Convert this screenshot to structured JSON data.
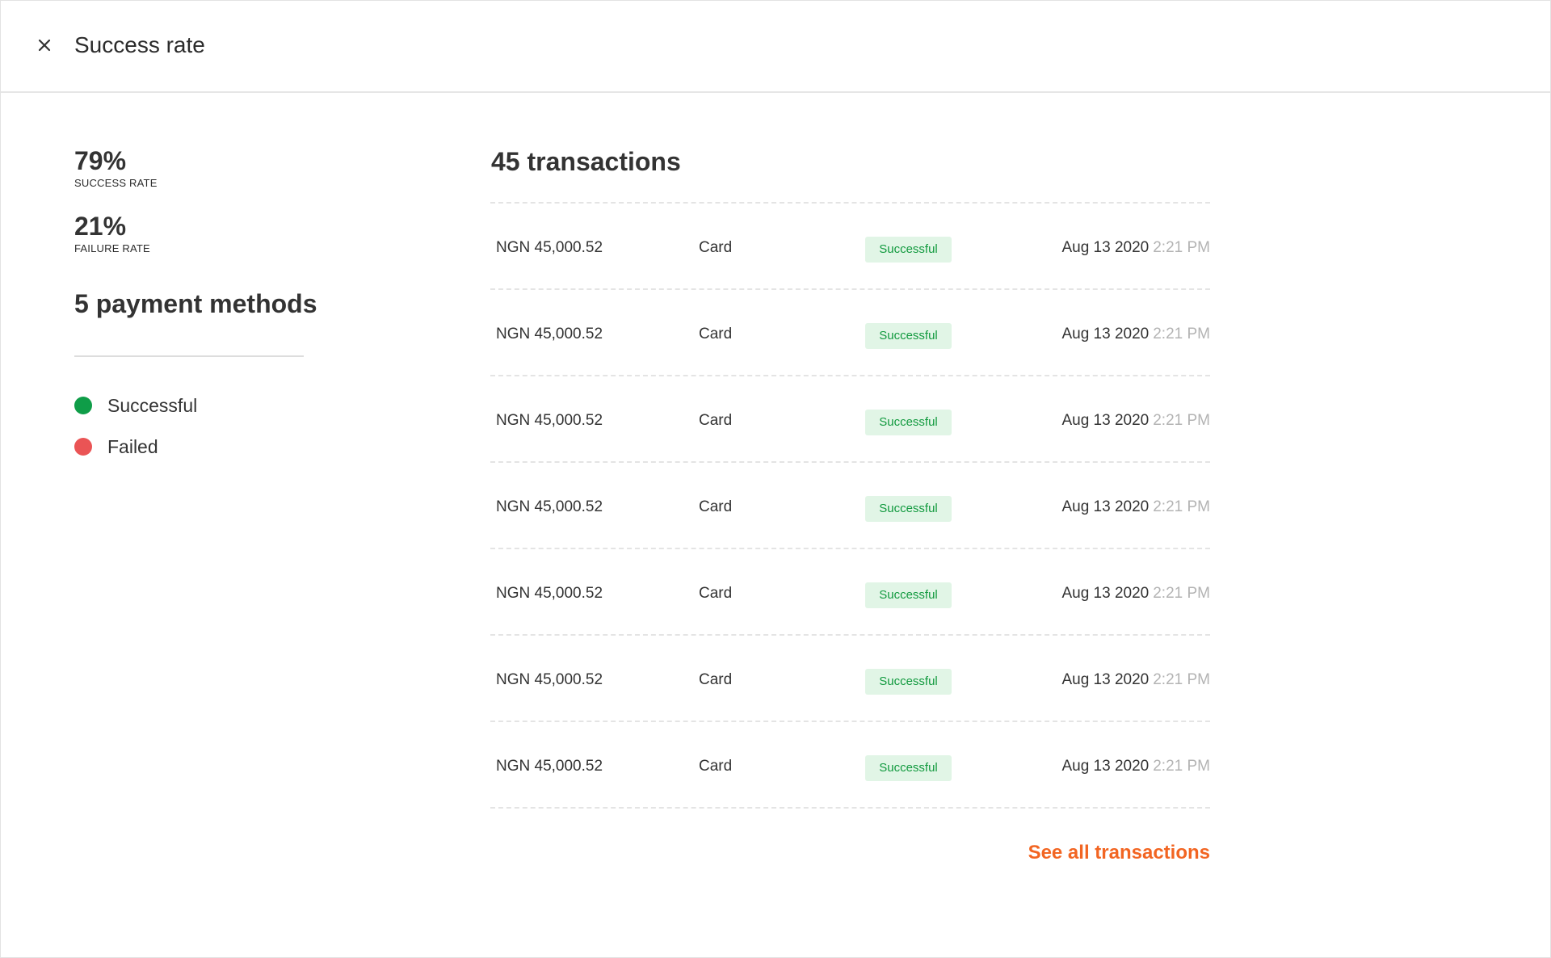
{
  "header": {
    "title": "Success rate",
    "close_icon": "close-icon"
  },
  "stats": {
    "success_rate": {
      "value": "79%",
      "label": "SUCCESS RATE"
    },
    "failure_rate": {
      "value": "21%",
      "label": "FAILURE RATE"
    }
  },
  "payment_methods": {
    "title": "5 payment methods"
  },
  "legend": [
    {
      "label": "Successful",
      "color": "#0f9d48"
    },
    {
      "label": "Failed",
      "color": "#ea5455"
    }
  ],
  "transactions": {
    "title": "45 transactions",
    "rows": [
      {
        "amount": "NGN 45,000.52",
        "method": "Card",
        "status": "Successful",
        "date": "Aug 13 2020",
        "time": "2:21 PM"
      },
      {
        "amount": "NGN 45,000.52",
        "method": "Card",
        "status": "Successful",
        "date": "Aug 13 2020",
        "time": "2:21 PM"
      },
      {
        "amount": "NGN 45,000.52",
        "method": "Card",
        "status": "Successful",
        "date": "Aug 13 2020",
        "time": "2:21 PM"
      },
      {
        "amount": "NGN 45,000.52",
        "method": "Card",
        "status": "Successful",
        "date": "Aug 13 2020",
        "time": "2:21 PM"
      },
      {
        "amount": "NGN 45,000.52",
        "method": "Card",
        "status": "Successful",
        "date": "Aug 13 2020",
        "time": "2:21 PM"
      },
      {
        "amount": "NGN 45,000.52",
        "method": "Card",
        "status": "Successful",
        "date": "Aug 13 2020",
        "time": "2:21 PM"
      },
      {
        "amount": "NGN 45,000.52",
        "method": "Card",
        "status": "Successful",
        "date": "Aug 13 2020",
        "time": "2:21 PM"
      }
    ],
    "see_all_label": "See all transactions"
  },
  "colors": {
    "accent": "#f26522",
    "success_badge_bg": "#e1f5e6",
    "success_badge_text": "#129a3f"
  }
}
